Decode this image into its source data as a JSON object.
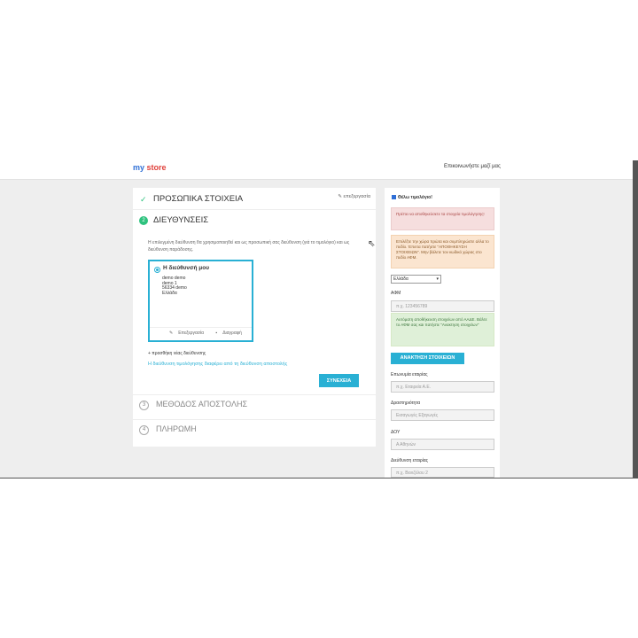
{
  "header": {
    "logo_my": "my",
    "logo_store": "store",
    "contact": "Επικοινωνήστε μαζί μας"
  },
  "steps": {
    "personal": {
      "title": "ΠΡΟΣΩΠΙΚΑ ΣΤΟΙΧΕΙΑ",
      "edit": "επεξεργασία",
      "icon": "check-icon"
    },
    "address": {
      "number": "2",
      "title": "ΔΙΕΥΘΥΝΣΕΙΣ",
      "description": "Η επιλεγμένη διεύθυνση θα χρησιμοποιηθεί και ως προσωπική σας διεύθυνση (γιά το τιμολόγιο) και ως διεύθυνση παράδοσης.",
      "card": {
        "name": "Η διεύθυνσή μου",
        "lines": [
          "demo demo",
          "demo 1",
          "56334 demo",
          "Ελλάδα"
        ],
        "edit_label": "Επεξεργασία",
        "delete_label": "Διαγραφή"
      },
      "add_new": "+ προσθήκη νέας διεύθυνσης",
      "billing_link": "Η διεύθυνση τιμολόγησης διαφέρει από τη διεύθυνση αποστολής",
      "continue_label": "ΣΥΝΕΧΕΙΑ"
    },
    "shipping": {
      "number": "3",
      "title": "ΜΕΘΟΔΟΣ ΑΠΟΣΤΟΛΗΣ"
    },
    "payment": {
      "number": "4",
      "title": "ΠΛΗΡΩΜΗ"
    }
  },
  "invoice": {
    "checkbox_label": "Θέλω τιμολόγιο!",
    "checked": true,
    "alert_red": "Πρέπει να αποθηκεύσετε τα στοιχεία τιμολόγησης!",
    "alert_orange": "Επιλέξτε την χώρα πρώτα και συμπληρώστε αλλα το πεδίο. Έπειτα πατήστε \"ΑΠΟΘΗΚΕΥΣΗ ΣΤΟΙΧΕΙΩΝ\". Μην βάλετε τον κωδικό χώρας στο πεδίο ΑΦΜ.",
    "country": "Ελλάδα",
    "vat_label": "ΑΦΜ",
    "vat_placeholder": "π.χ. 123456789",
    "alert_green": "Αυτόματη αποθήκευση στοιχείων από ΑΑΔΕ. Βάλτε το ΑΦΜ σας και πατήστε \"Ανακτηση στοιχείων\"",
    "retrieve_label": "ΑΝΑΚΤΗΣΗ ΣΤΟΙΧΕΙΩΝ",
    "company_label": "Επωνυμία εταιρίας",
    "company_placeholder": "π.χ. Εταιρεία Α.Ε.",
    "activity_label": "Δραστηριότητα",
    "activity_placeholder": "Εισαγωγές Εξαγωγές",
    "tax_office_label": "ΔΟΥ",
    "tax_office_placeholder": "Α Αθηνών",
    "company_address_label": "Διεύθυνση εταιρίας",
    "company_address_placeholder": "π.χ. Βενιζέλου 2"
  },
  "colors": {
    "accent": "#29b0d4",
    "success": "#2ec27e"
  }
}
